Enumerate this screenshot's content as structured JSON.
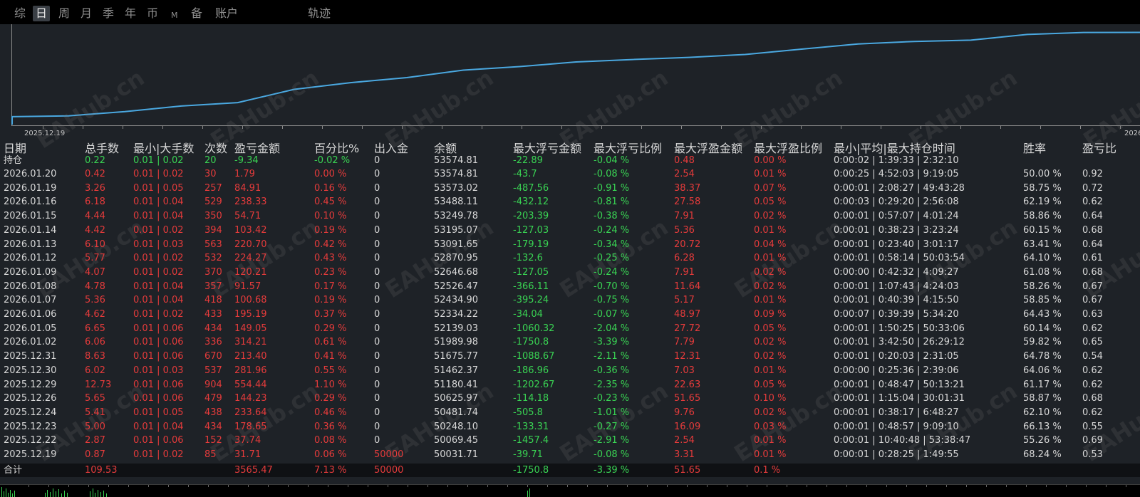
{
  "tabs": [
    {
      "label": "综",
      "active": false
    },
    {
      "label": "日",
      "active": true
    },
    {
      "label": "周",
      "active": false
    },
    {
      "label": "月",
      "active": false
    },
    {
      "label": "季",
      "active": false
    },
    {
      "label": "年",
      "active": false
    },
    {
      "label": "币",
      "active": false
    },
    {
      "label": "M",
      "active": false
    },
    {
      "label": "备",
      "active": false
    },
    {
      "label": "账户",
      "active": false
    },
    {
      "label": "轨迹",
      "active": false
    }
  ],
  "chart": {
    "start_label": "2025.12.19",
    "end_label": "2026",
    "line_color": "#4aa8e0",
    "watermark": "EAHub.cn"
  },
  "chart_data": {
    "type": "line",
    "x": [
      "2025.12.19",
      "2025.12.22",
      "2025.12.23",
      "2025.12.24",
      "2025.12.26",
      "2025.12.29",
      "2025.12.30",
      "2025.12.31",
      "2026.01.02",
      "2026.01.05",
      "2026.01.06",
      "2026.01.07",
      "2026.01.08",
      "2026.01.09",
      "2026.01.12",
      "2026.01.13",
      "2026.01.14",
      "2026.01.15",
      "2026.01.16",
      "2026.01.19",
      "2026.01.20"
    ],
    "values": [
      50031.71,
      50069.45,
      50248.1,
      50481.74,
      50625.97,
      51180.41,
      51462.37,
      51675.77,
      51989.98,
      52139.03,
      52334.22,
      52434.9,
      52526.47,
      52646.68,
      52870.95,
      53091.65,
      53195.07,
      53249.78,
      53488.11,
      53573.02,
      53574.81
    ]
  },
  "columns": [
    "日期",
    "总手数",
    "最小|大手数",
    "次数",
    "盈亏金额",
    "百分比%",
    "出入金",
    "余额",
    "最大浮亏金额",
    "最大浮亏比例",
    "最大浮盈金额",
    "最大浮盈比例",
    "最小|平均|最大持仓时间",
    "胜率",
    "盈亏比"
  ],
  "holding": {
    "date": "持仓",
    "lots": "0.22",
    "minmax": "0.01 | 0.02",
    "count": "20",
    "pnl": "-9.34",
    "pct": "-0.02 %",
    "flow": "0",
    "balance": "53574.81",
    "maxdd": "-22.89",
    "maxdd_pct": "-0.04 %",
    "maxfp": "0.48",
    "maxfp_pct": "0.00 %",
    "hold": "0:00:02 | 1:39:33 | 2:32:10"
  },
  "rows": [
    {
      "date": "2026.01.20",
      "lots": "0.42",
      "minmax": "0.01 | 0.02",
      "count": "30",
      "pnl": "1.79",
      "pct": "0.00 %",
      "flow": "0",
      "balance": "53574.81",
      "maxdd": "-43.7",
      "maxdd_pct": "-0.08 %",
      "maxfp": "2.54",
      "maxfp_pct": "0.01 %",
      "hold": "0:00:25 | 4:52:03 | 9:19:05",
      "win": "50.00 %",
      "pf": "0.92"
    },
    {
      "date": "2026.01.19",
      "lots": "3.26",
      "minmax": "0.01 | 0.05",
      "count": "257",
      "pnl": "84.91",
      "pct": "0.16 %",
      "flow": "0",
      "balance": "53573.02",
      "maxdd": "-487.56",
      "maxdd_pct": "-0.91 %",
      "maxfp": "38.37",
      "maxfp_pct": "0.07 %",
      "hold": "0:00:01 | 2:08:27 | 49:43:28",
      "win": "58.75 %",
      "pf": "0.72"
    },
    {
      "date": "2026.01.16",
      "lots": "6.18",
      "minmax": "0.01 | 0.04",
      "count": "529",
      "pnl": "238.33",
      "pct": "0.45 %",
      "flow": "0",
      "balance": "53488.11",
      "maxdd": "-432.12",
      "maxdd_pct": "-0.81 %",
      "maxfp": "27.58",
      "maxfp_pct": "0.05 %",
      "hold": "0:00:03 | 0:29:20 | 2:56:08",
      "win": "62.19 %",
      "pf": "0.62"
    },
    {
      "date": "2026.01.15",
      "lots": "4.44",
      "minmax": "0.01 | 0.04",
      "count": "350",
      "pnl": "54.71",
      "pct": "0.10 %",
      "flow": "0",
      "balance": "53249.78",
      "maxdd": "-203.39",
      "maxdd_pct": "-0.38 %",
      "maxfp": "7.91",
      "maxfp_pct": "0.02 %",
      "hold": "0:00:01 | 0:57:07 | 4:01:24",
      "win": "58.86 %",
      "pf": "0.64"
    },
    {
      "date": "2026.01.14",
      "lots": "4.42",
      "minmax": "0.01 | 0.02",
      "count": "394",
      "pnl": "103.42",
      "pct": "0.19 %",
      "flow": "0",
      "balance": "53195.07",
      "maxdd": "-127.03",
      "maxdd_pct": "-0.24 %",
      "maxfp": "5.36",
      "maxfp_pct": "0.01 %",
      "hold": "0:00:01 | 0:38:23 | 3:23:24",
      "win": "60.15 %",
      "pf": "0.68"
    },
    {
      "date": "2026.01.13",
      "lots": "6.10",
      "minmax": "0.01 | 0.03",
      "count": "563",
      "pnl": "220.70",
      "pct": "0.42 %",
      "flow": "0",
      "balance": "53091.65",
      "maxdd": "-179.19",
      "maxdd_pct": "-0.34 %",
      "maxfp": "20.72",
      "maxfp_pct": "0.04 %",
      "hold": "0:00:01 | 0:23:40 | 3:01:17",
      "win": "63.41 %",
      "pf": "0.64"
    },
    {
      "date": "2026.01.12",
      "lots": "5.77",
      "minmax": "0.01 | 0.02",
      "count": "532",
      "pnl": "224.27",
      "pct": "0.43 %",
      "flow": "0",
      "balance": "52870.95",
      "maxdd": "-132.6",
      "maxdd_pct": "-0.25 %",
      "maxfp": "6.28",
      "maxfp_pct": "0.01 %",
      "hold": "0:00:01 | 0:58:14 | 50:03:54",
      "win": "64.10 %",
      "pf": "0.61"
    },
    {
      "date": "2026.01.09",
      "lots": "4.07",
      "minmax": "0.01 | 0.02",
      "count": "370",
      "pnl": "120.21",
      "pct": "0.23 %",
      "flow": "0",
      "balance": "52646.68",
      "maxdd": "-127.05",
      "maxdd_pct": "-0.24 %",
      "maxfp": "7.91",
      "maxfp_pct": "0.02 %",
      "hold": "0:00:00 | 0:42:32 | 4:09:27",
      "win": "61.08 %",
      "pf": "0.68"
    },
    {
      "date": "2026.01.08",
      "lots": "4.78",
      "minmax": "0.01 | 0.04",
      "count": "357",
      "pnl": "91.57",
      "pct": "0.17 %",
      "flow": "0",
      "balance": "52526.47",
      "maxdd": "-366.11",
      "maxdd_pct": "-0.70 %",
      "maxfp": "11.64",
      "maxfp_pct": "0.02 %",
      "hold": "0:00:01 | 1:07:43 | 4:24:03",
      "win": "58.26 %",
      "pf": "0.67"
    },
    {
      "date": "2026.01.07",
      "lots": "5.36",
      "minmax": "0.01 | 0.04",
      "count": "418",
      "pnl": "100.68",
      "pct": "0.19 %",
      "flow": "0",
      "balance": "52434.90",
      "maxdd": "-395.24",
      "maxdd_pct": "-0.75 %",
      "maxfp": "5.17",
      "maxfp_pct": "0.01 %",
      "hold": "0:00:01 | 0:40:39 | 4:15:50",
      "win": "58.85 %",
      "pf": "0.67"
    },
    {
      "date": "2026.01.06",
      "lots": "4.62",
      "minmax": "0.01 | 0.02",
      "count": "433",
      "pnl": "195.19",
      "pct": "0.37 %",
      "flow": "0",
      "balance": "52334.22",
      "maxdd": "-34.04",
      "maxdd_pct": "-0.07 %",
      "maxfp": "48.97",
      "maxfp_pct": "0.09 %",
      "hold": "0:00:07 | 0:39:39 | 5:34:20",
      "win": "64.43 %",
      "pf": "0.63"
    },
    {
      "date": "2026.01.05",
      "lots": "6.65",
      "minmax": "0.01 | 0.06",
      "count": "434",
      "pnl": "149.05",
      "pct": "0.29 %",
      "flow": "0",
      "balance": "52139.03",
      "maxdd": "-1060.32",
      "maxdd_pct": "-2.04 %",
      "maxfp": "27.72",
      "maxfp_pct": "0.05 %",
      "hold": "0:00:01 | 1:50:25 | 50:33:06",
      "win": "60.14 %",
      "pf": "0.62"
    },
    {
      "date": "2026.01.02",
      "lots": "6.06",
      "minmax": "0.01 | 0.06",
      "count": "336",
      "pnl": "314.21",
      "pct": "0.61 %",
      "flow": "0",
      "balance": "51989.98",
      "maxdd": "-1750.8",
      "maxdd_pct": "-3.39 %",
      "maxfp": "7.79",
      "maxfp_pct": "0.02 %",
      "hold": "0:00:01 | 3:42:50 | 26:29:12",
      "win": "59.82 %",
      "pf": "0.65"
    },
    {
      "date": "2025.12.31",
      "lots": "8.63",
      "minmax": "0.01 | 0.06",
      "count": "670",
      "pnl": "213.40",
      "pct": "0.41 %",
      "flow": "0",
      "balance": "51675.77",
      "maxdd": "-1088.67",
      "maxdd_pct": "-2.11 %",
      "maxfp": "12.31",
      "maxfp_pct": "0.02 %",
      "hold": "0:00:01 | 0:20:03 | 2:31:05",
      "win": "64.78 %",
      "pf": "0.54"
    },
    {
      "date": "2025.12.30",
      "lots": "6.02",
      "minmax": "0.01 | 0.03",
      "count": "537",
      "pnl": "281.96",
      "pct": "0.55 %",
      "flow": "0",
      "balance": "51462.37",
      "maxdd": "-186.96",
      "maxdd_pct": "-0.36 %",
      "maxfp": "7.03",
      "maxfp_pct": "0.01 %",
      "hold": "0:00:00 | 0:25:36 | 2:39:06",
      "win": "64.06 %",
      "pf": "0.62"
    },
    {
      "date": "2025.12.29",
      "lots": "12.73",
      "minmax": "0.01 | 0.06",
      "count": "904",
      "pnl": "554.44",
      "pct": "1.10 %",
      "flow": "0",
      "balance": "51180.41",
      "maxdd": "-1202.67",
      "maxdd_pct": "-2.35 %",
      "maxfp": "22.63",
      "maxfp_pct": "0.05 %",
      "hold": "0:00:01 | 0:48:47 | 50:13:21",
      "win": "61.17 %",
      "pf": "0.62"
    },
    {
      "date": "2025.12.26",
      "lots": "5.65",
      "minmax": "0.01 | 0.06",
      "count": "479",
      "pnl": "144.23",
      "pct": "0.29 %",
      "flow": "0",
      "balance": "50625.97",
      "maxdd": "-114.18",
      "maxdd_pct": "-0.23 %",
      "maxfp": "51.65",
      "maxfp_pct": "0.10 %",
      "hold": "0:00:01 | 1:15:04 | 30:01:31",
      "win": "58.87 %",
      "pf": "0.68"
    },
    {
      "date": "2025.12.24",
      "lots": "5.41",
      "minmax": "0.01 | 0.05",
      "count": "438",
      "pnl": "233.64",
      "pct": "0.46 %",
      "flow": "0",
      "balance": "50481.74",
      "maxdd": "-505.8",
      "maxdd_pct": "-1.01 %",
      "maxfp": "9.76",
      "maxfp_pct": "0.02 %",
      "hold": "0:00:01 | 0:38:17 | 6:48:27",
      "win": "62.10 %",
      "pf": "0.62"
    },
    {
      "date": "2025.12.23",
      "lots": "5.00",
      "minmax": "0.01 | 0.04",
      "count": "434",
      "pnl": "178.65",
      "pct": "0.36 %",
      "flow": "0",
      "balance": "50248.10",
      "maxdd": "-133.31",
      "maxdd_pct": "-0.27 %",
      "maxfp": "16.09",
      "maxfp_pct": "0.03 %",
      "hold": "0:00:01 | 0:48:57 | 9:09:10",
      "win": "66.13 %",
      "pf": "0.55"
    },
    {
      "date": "2025.12.22",
      "lots": "2.87",
      "minmax": "0.01 | 0.06",
      "count": "152",
      "pnl": "37.74",
      "pct": "0.08 %",
      "flow": "0",
      "balance": "50069.45",
      "maxdd": "-1457.4",
      "maxdd_pct": "-2.91 %",
      "maxfp": "2.54",
      "maxfp_pct": "0.01 %",
      "hold": "0:00:01 | 10:40:48 | 53:38:47",
      "win": "55.26 %",
      "pf": "0.69"
    },
    {
      "date": "2025.12.19",
      "lots": "0.87",
      "minmax": "0.01 | 0.02",
      "count": "85",
      "pnl": "31.71",
      "pct": "0.06 %",
      "flow": "50000",
      "balance": "50031.71",
      "maxdd": "-39.71",
      "maxdd_pct": "-0.08 %",
      "maxfp": "3.31",
      "maxfp_pct": "0.01 %",
      "hold": "0:00:01 | 0:28:25 | 1:49:55",
      "win": "68.24 %",
      "pf": "0.53"
    }
  ],
  "total": {
    "label": "合计",
    "lots": "109.53",
    "pnl": "3565.47",
    "pct": "7.13 %",
    "flow": "50000",
    "maxdd": "-1750.8",
    "maxdd_pct": "-3.39 %",
    "maxfp": "51.65",
    "maxfp_pct": "0.1 %"
  }
}
